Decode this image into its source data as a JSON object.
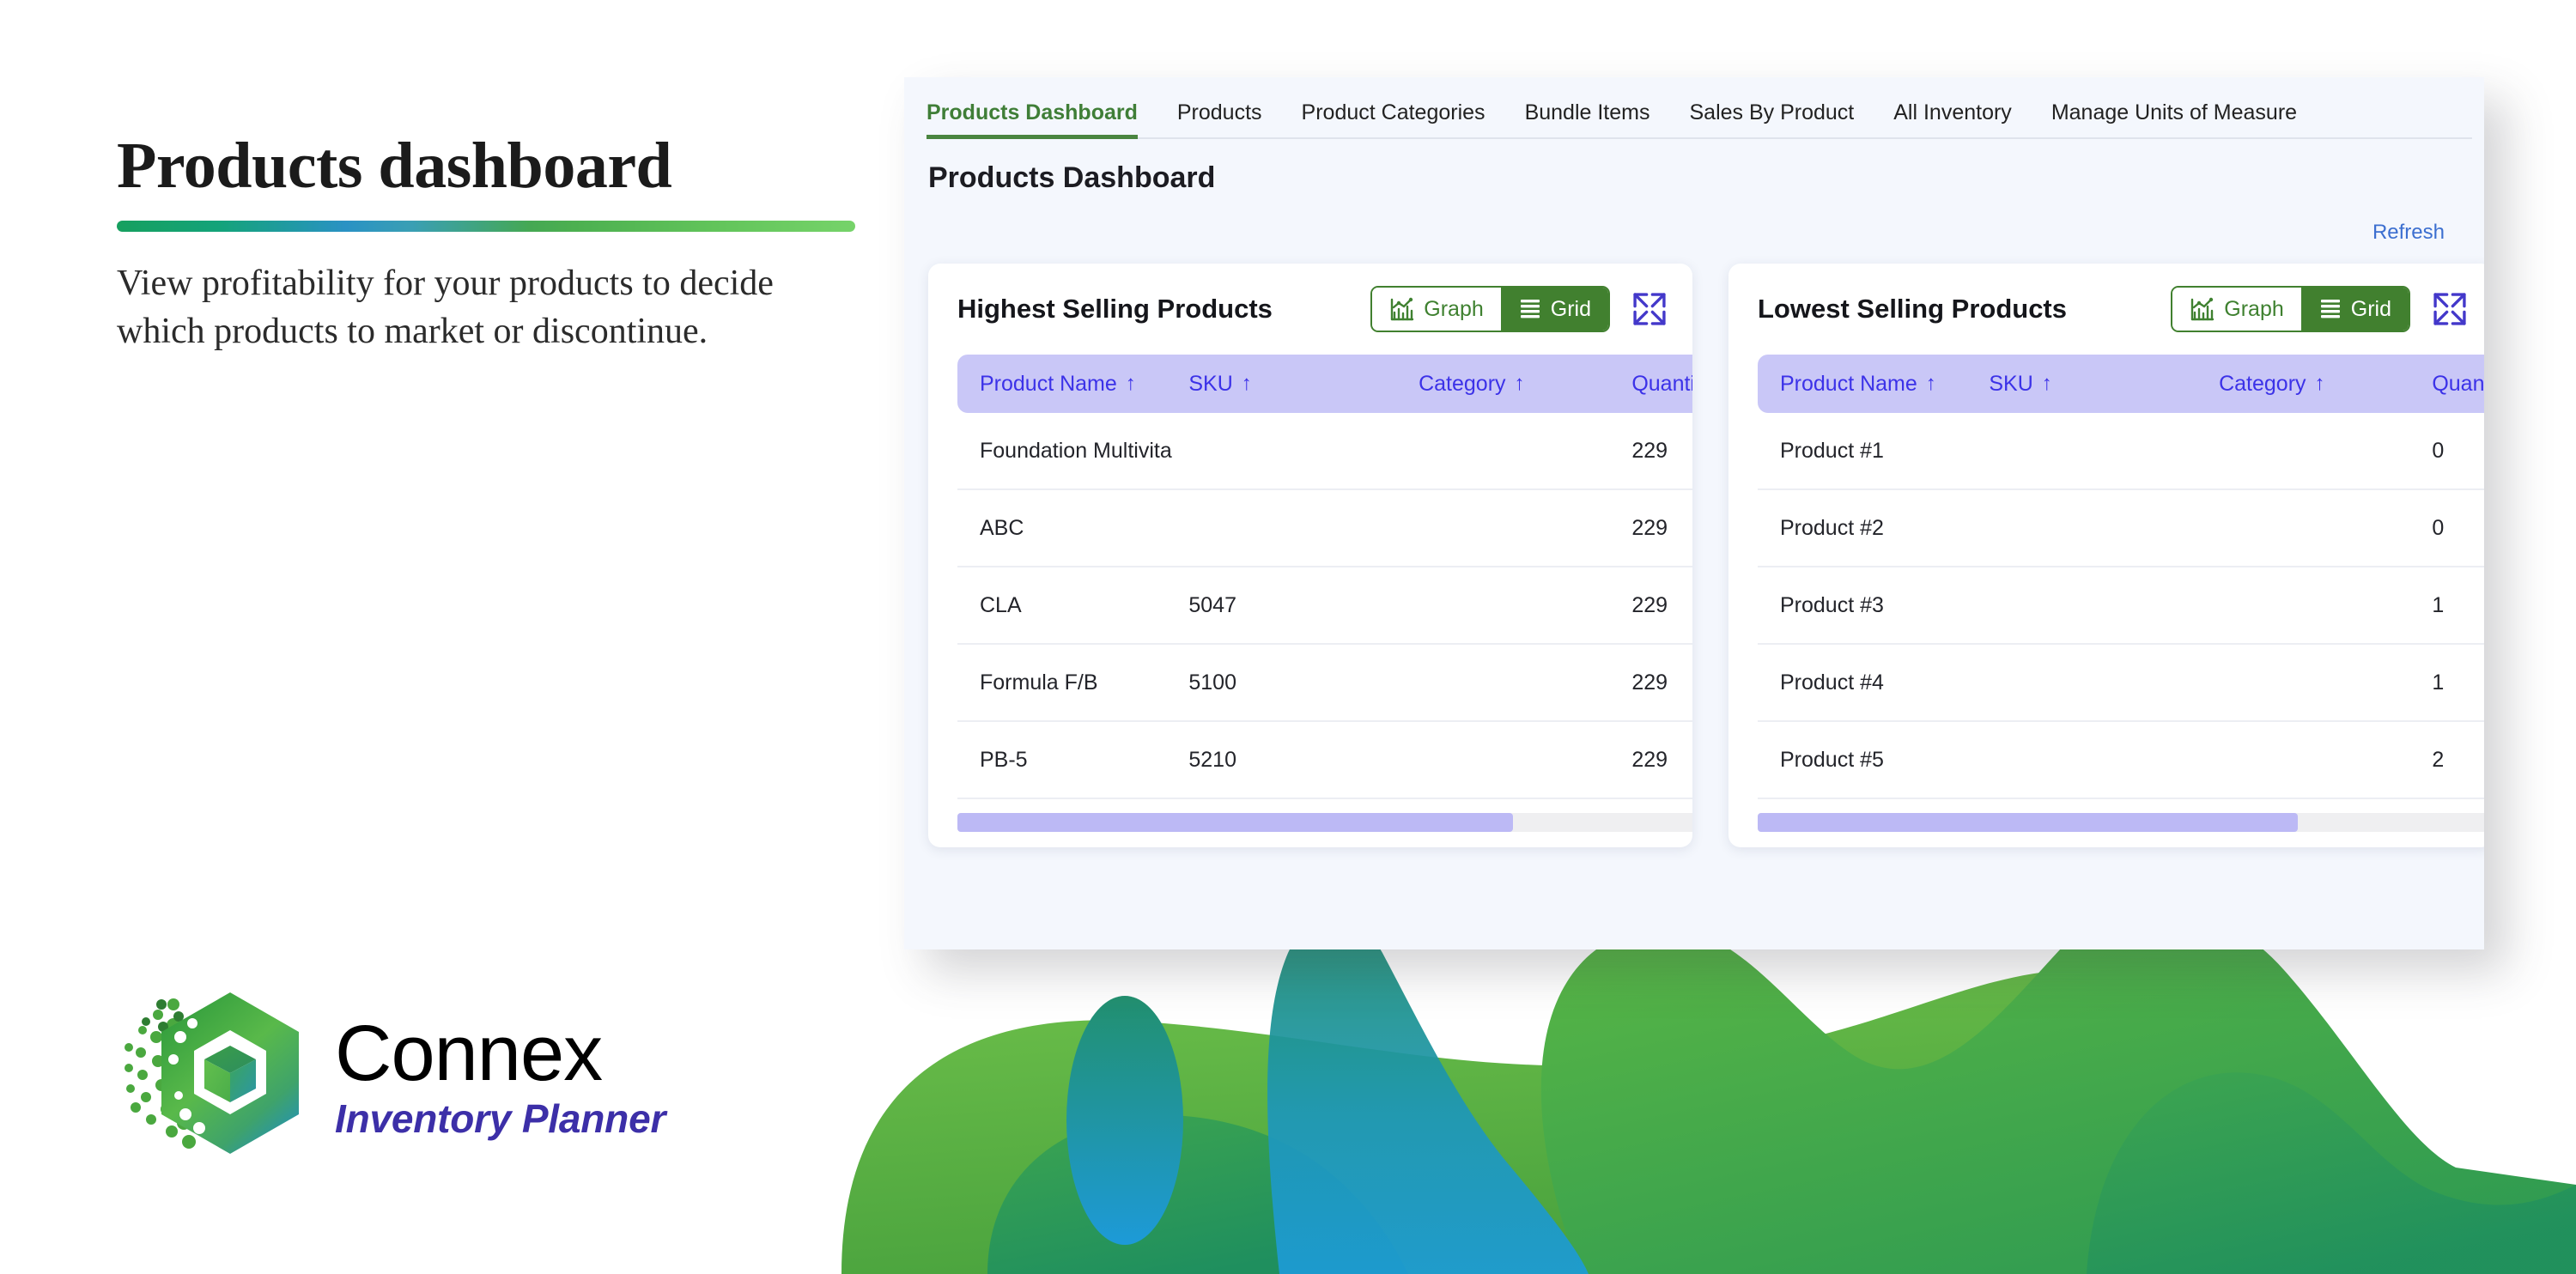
{
  "promo": {
    "title": "Products dashboard",
    "subtitle": "View profitability for your products to decide which products to market or discontinue."
  },
  "logo": {
    "name": "Connex",
    "tagline": "Inventory Planner",
    "mark_icon": "hexagon-cube-logo-icon"
  },
  "app": {
    "tabs": [
      {
        "label": "Products Dashboard",
        "active": true
      },
      {
        "label": "Products",
        "active": false
      },
      {
        "label": "Product Categories",
        "active": false
      },
      {
        "label": "Bundle Items",
        "active": false
      },
      {
        "label": "Sales By Product",
        "active": false
      },
      {
        "label": "All Inventory",
        "active": false
      },
      {
        "label": "Manage Units of Measure",
        "active": false
      }
    ],
    "page_title": "Products Dashboard",
    "refresh_label": "Refresh"
  },
  "toggle": {
    "graph_label": "Graph",
    "grid_label": "Grid",
    "graph_icon": "bar-chart-icon",
    "grid_icon": "grid-rows-icon",
    "expand_icon": "expand-arrows-icon",
    "selected": "Grid"
  },
  "columns": {
    "product_name": "Product Name",
    "sku": "SKU",
    "category": "Category",
    "quantity_sold": "Quantity Sold",
    "quantity_sold_clipped": "Quantity S",
    "sort_icon": "↑"
  },
  "cards": [
    {
      "title": "Highest Selling Products",
      "rows": [
        {
          "name": "Foundation Multivita",
          "sku": "",
          "category": "",
          "qty": "229"
        },
        {
          "name": "ABC",
          "sku": "",
          "category": "",
          "qty": "229"
        },
        {
          "name": "CLA",
          "sku": "5047",
          "category": "",
          "qty": "229"
        },
        {
          "name": "Formula F/B",
          "sku": "5100",
          "category": "",
          "qty": "229"
        },
        {
          "name": "PB-5",
          "sku": "5210",
          "category": "",
          "qty": "229"
        }
      ],
      "scroll_percent": 75
    },
    {
      "title": "Lowest Selling Products",
      "rows": [
        {
          "name": "Product #1",
          "sku": "",
          "category": "",
          "qty": "0"
        },
        {
          "name": "Product #2",
          "sku": "",
          "category": "",
          "qty": "0"
        },
        {
          "name": "Product #3",
          "sku": "",
          "category": "",
          "qty": "1"
        },
        {
          "name": "Product #4",
          "sku": "",
          "category": "",
          "qty": "1"
        },
        {
          "name": "Product #5",
          "sku": "",
          "category": "",
          "qty": "2"
        }
      ],
      "scroll_percent": 73
    }
  ],
  "colors": {
    "brand_green": "#41802f",
    "tab_active_green": "#3f7e37",
    "header_lavender": "#c9c7f7",
    "header_text_indigo": "#3c32e8",
    "link_blue": "#3c6fd0",
    "logo_purple": "#3c2fa8",
    "panel_bg": "#f4f7fd"
  }
}
